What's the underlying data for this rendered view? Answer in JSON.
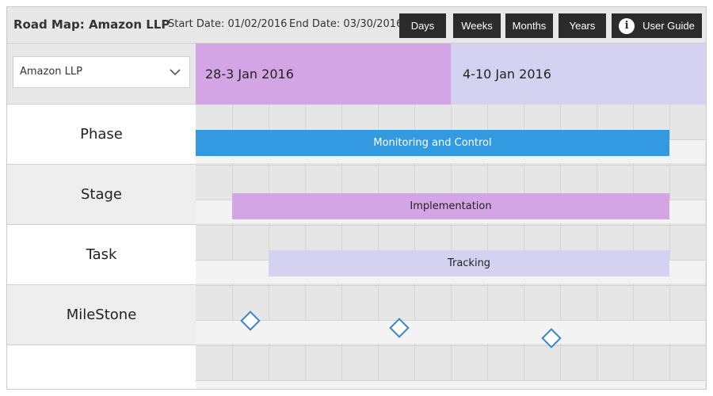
{
  "header": {
    "title": "Road Map: Amazon LLP",
    "start_date": "Start Date: 01/02/2016",
    "end_date": "End Date: 03/30/2016",
    "buttons": [
      "Days",
      "Weeks",
      "Months",
      "Years"
    ],
    "user_guide": "User Guide",
    "info_glyph": "i"
  },
  "company_select": {
    "value": "Amazon LLP"
  },
  "weeks": [
    {
      "label": "28-3 Jan 2016",
      "color": "#d4a5e5"
    },
    {
      "label": "4-10 Jan 2016",
      "color": "#d4d1f1"
    }
  ],
  "rows": [
    "Phase",
    "Stage",
    "Task",
    "MileStone",
    ""
  ],
  "bars": [
    {
      "label": "Monitoring and Control",
      "color": "#3399e0",
      "text_color": "#ffffff"
    },
    {
      "label": "Implementation",
      "color": "#d4a5e5",
      "text_color": "#222222"
    },
    {
      "label": "Tracking",
      "color": "#d4d1f1",
      "text_color": "#222222"
    }
  ],
  "icons": {
    "select_chevron": "chevron-down-icon",
    "info": "info-icon",
    "milestone": "diamond-icon"
  }
}
